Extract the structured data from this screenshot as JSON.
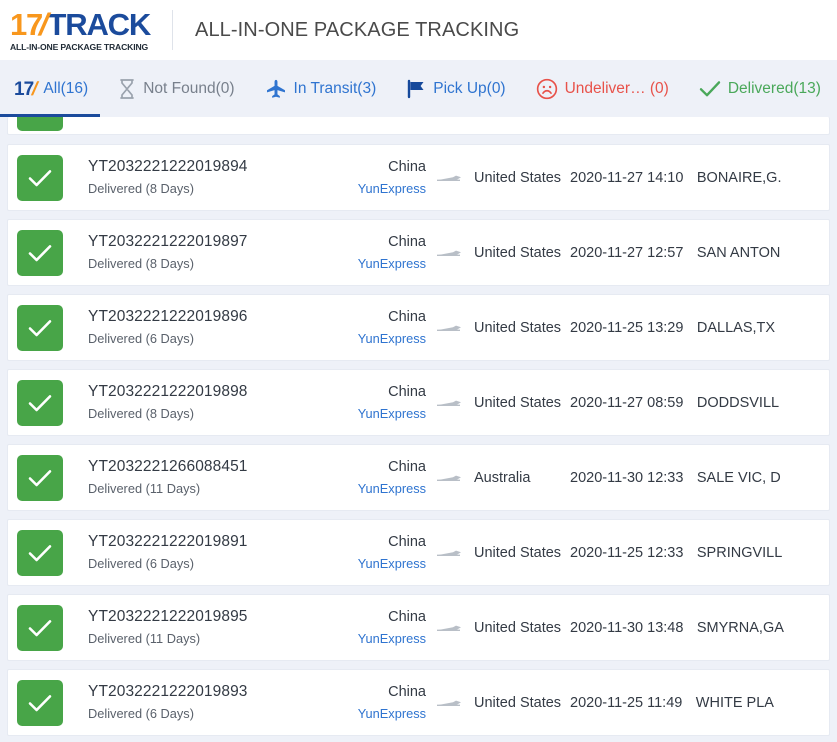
{
  "header": {
    "logo_17": "17",
    "logo_track": "TRACK",
    "logo_tagline": "ALL-IN-ONE PACKAGE TRACKING",
    "title": "ALL-IN-ONE PACKAGE TRACKING"
  },
  "tabs": [
    {
      "id": "all",
      "label": "All(16)",
      "icon": "17-logo-icon",
      "active": true
    },
    {
      "id": "notfound",
      "label": "Not Found(0)",
      "icon": "hourglass-icon",
      "active": false
    },
    {
      "id": "intransit",
      "label": "In Transit(3)",
      "icon": "airplane-icon",
      "active": false
    },
    {
      "id": "pickup",
      "label": "Pick Up(0)",
      "icon": "flag-icon",
      "active": false
    },
    {
      "id": "undelivered",
      "label": "Undeliver… (0)",
      "icon": "sad-face-icon",
      "active": false
    },
    {
      "id": "delivered",
      "label": "Delivered(13)",
      "icon": "checkmark-icon",
      "active": false
    },
    {
      "id": "warning",
      "label": "",
      "icon": "warning-triangle-icon",
      "active": false
    }
  ],
  "colors": {
    "brand_blue": "#1b4b9c",
    "brand_orange": "#f8971d",
    "link_blue": "#2f74d0",
    "delivered_green": "#48a548",
    "undelivered_red": "#e8524a",
    "warning_orange": "#ff6a00",
    "page_bg": "#eef1f8"
  },
  "rows": [
    {
      "status_icon": "checkmark-icon",
      "tracking_number": "YT2032221222019894",
      "status_text": "Delivered (8 Days)",
      "origin_country": "China",
      "carrier": "YunExpress",
      "destination_country": "United States",
      "last_event_time": "2020-11-27 14:10",
      "last_event_place": "BONAIRE,G."
    },
    {
      "status_icon": "checkmark-icon",
      "tracking_number": "YT2032221222019897",
      "status_text": "Delivered (8 Days)",
      "origin_country": "China",
      "carrier": "YunExpress",
      "destination_country": "United States",
      "last_event_time": "2020-11-27 12:57",
      "last_event_place": "SAN ANTON"
    },
    {
      "status_icon": "checkmark-icon",
      "tracking_number": "YT2032221222019896",
      "status_text": "Delivered (6 Days)",
      "origin_country": "China",
      "carrier": "YunExpress",
      "destination_country": "United States",
      "last_event_time": "2020-11-25 13:29",
      "last_event_place": "DALLAS,TX"
    },
    {
      "status_icon": "checkmark-icon",
      "tracking_number": "YT2032221222019898",
      "status_text": "Delivered (8 Days)",
      "origin_country": "China",
      "carrier": "YunExpress",
      "destination_country": "United States",
      "last_event_time": "2020-11-27 08:59",
      "last_event_place": "DODDSVILL"
    },
    {
      "status_icon": "checkmark-icon",
      "tracking_number": "YT2032221266088451",
      "status_text": "Delivered (11 Days)",
      "origin_country": "China",
      "carrier": "YunExpress",
      "destination_country": "Australia",
      "last_event_time": "2020-11-30 12:33",
      "last_event_place": "SALE VIC, D"
    },
    {
      "status_icon": "checkmark-icon",
      "tracking_number": "YT2032221222019891",
      "status_text": "Delivered (6 Days)",
      "origin_country": "China",
      "carrier": "YunExpress",
      "destination_country": "United States",
      "last_event_time": "2020-11-25 12:33",
      "last_event_place": "SPRINGVILL"
    },
    {
      "status_icon": "checkmark-icon",
      "tracking_number": "YT2032221222019895",
      "status_text": "Delivered (11 Days)",
      "origin_country": "China",
      "carrier": "YunExpress",
      "destination_country": "United States",
      "last_event_time": "2020-11-30 13:48",
      "last_event_place": "SMYRNA,GA"
    },
    {
      "status_icon": "checkmark-icon",
      "tracking_number": "YT2032221222019893",
      "status_text": "Delivered (6 Days)",
      "origin_country": "China",
      "carrier": "YunExpress",
      "destination_country": "United States",
      "last_event_time": "2020-11-25 11:49",
      "last_event_place": "WHITE PLA"
    }
  ]
}
